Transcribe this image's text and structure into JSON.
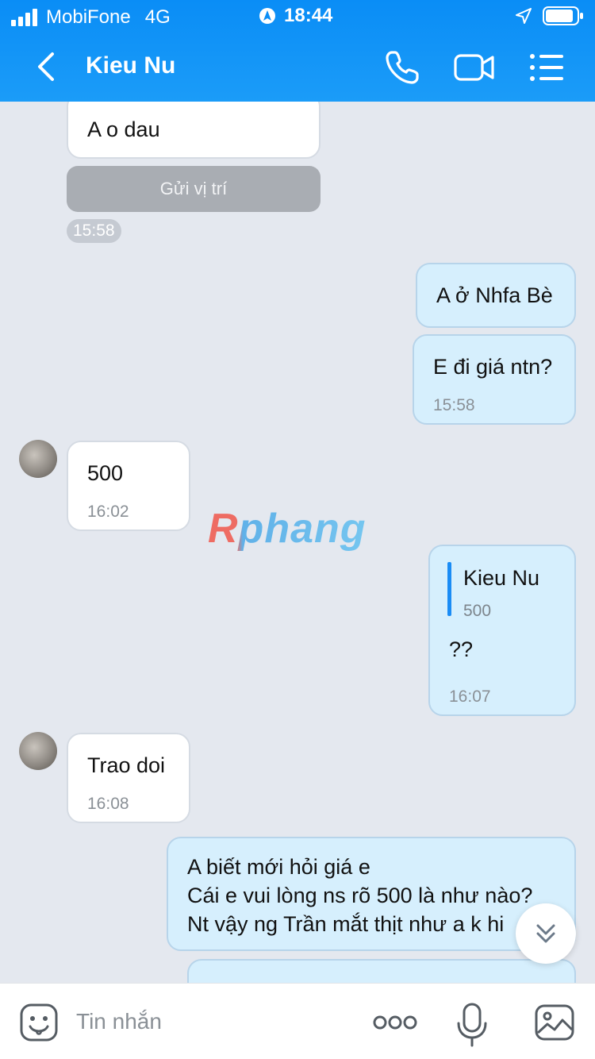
{
  "status": {
    "carrier": "MobiFone",
    "network": "4G",
    "time": "18:44"
  },
  "header": {
    "title": "Kieu Nu"
  },
  "chat": {
    "m1_text": "A o dau",
    "m1_location_label": "Gửi vị trí",
    "m1_time": "15:58",
    "m2_text": "A ở Nhfa Bè",
    "m3_text": "E đi giá ntn?",
    "m3_time": "15:58",
    "m4_text": "500",
    "m4_time": "16:02",
    "m5_quote_name": "Kieu Nu",
    "m5_quote_text": "500",
    "m5_text": "??",
    "m5_time": "16:07",
    "m6_text": "Trao doi",
    "m6_time": "16:08",
    "m7_line1": "A biết mới hỏi giá e",
    "m7_line2": "Cái e vui lòng ns rõ 500 là như nào?",
    "m7_line3": "Nt vậy ng Trần mắt thịt như a k hi"
  },
  "watermark": "Rphang",
  "composer": {
    "placeholder": "Tin nhắn"
  },
  "colors": {
    "header": "#0a8df6",
    "outgoing_bubble": "#d6effd",
    "incoming_bubble": "#ffffff",
    "background": "#e4e8ef"
  }
}
